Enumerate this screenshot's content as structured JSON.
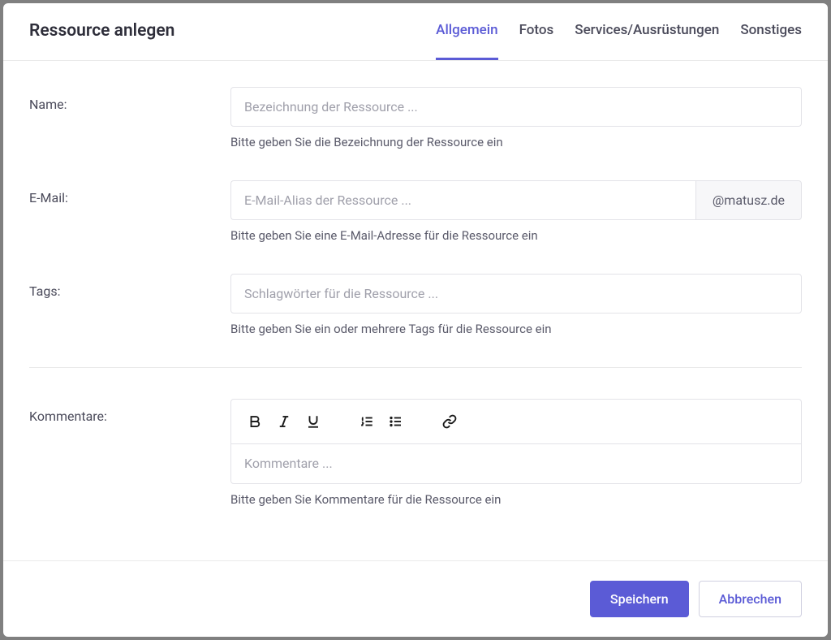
{
  "header": {
    "title": "Ressource anlegen",
    "tabs": [
      {
        "label": "Allgemein",
        "active": true
      },
      {
        "label": "Fotos",
        "active": false
      },
      {
        "label": "Services/Ausrüstungen",
        "active": false
      },
      {
        "label": "Sonstiges",
        "active": false
      }
    ]
  },
  "fields": {
    "name": {
      "label": "Name:",
      "placeholder": "Bezeichnung der Ressource ...",
      "help": "Bitte geben Sie die Bezeichnung der Ressource ein"
    },
    "email": {
      "label": "E-Mail:",
      "placeholder": "E-Mail-Alias der Ressource ...",
      "addon": "@matusz.de",
      "help": "Bitte geben Sie eine E-Mail-Adresse für die Ressource ein"
    },
    "tags": {
      "label": "Tags:",
      "placeholder": "Schlagwörter für die Ressource ...",
      "help": "Bitte geben Sie ein oder mehrere Tags für die Ressource ein"
    },
    "comments": {
      "label": "Kommentare:",
      "placeholder": "Kommentare ...",
      "help": "Bitte geben Sie Kommentare für die Ressource ein"
    }
  },
  "footer": {
    "save": "Speichern",
    "cancel": "Abbrechen"
  }
}
